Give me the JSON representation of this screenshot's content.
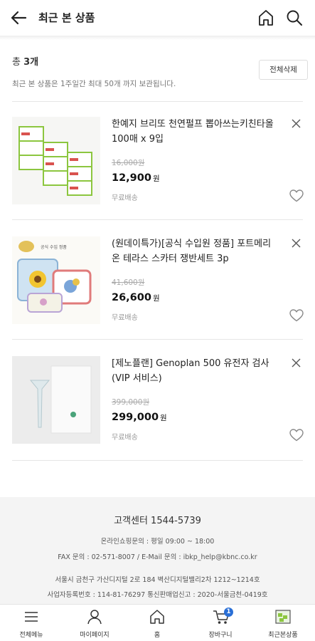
{
  "header": {
    "title": "최근 본 상품"
  },
  "summary": {
    "count_prefix": "총 ",
    "count_value": "3개",
    "note": "최근 본 상품은 1주일간 최대 50개 까지 보관됩니다.",
    "clear_all": "전체삭제"
  },
  "products": [
    {
      "name": "한예지 브리또 천연펄프 뽑아쓰는키친타올 100매 x 9입",
      "original_price": "16,000원",
      "price": "12,900",
      "currency": "원",
      "shipping": "무료배송"
    },
    {
      "name": "(원데이특가)[공식 수입원 정품] 포트메리온 테라스 스카터 쟁반세트 3p",
      "original_price": "41,600원",
      "price": "26,600",
      "currency": "원",
      "shipping": "무료배송",
      "thumb_label": "공식 수입 정품"
    },
    {
      "name": "[제노플랜] Genoplan 500 유전자 검사 (VIP 서비스)",
      "original_price": "399,000원",
      "price": "299,000",
      "currency": "원",
      "shipping": "무료배송"
    }
  ],
  "footer": {
    "cs": "고객센터 1544-5739",
    "hours": "온라인쇼핑문의 : 평일 09:00 ~ 18:00",
    "contact": "FAX 문의 : 02-571-8007 / E-Mail 문의 : ibkp_help@kbnc.co.kr",
    "address": "서울시 금천구 가산디지털 2로 184 벽산디지털밸리2차 1212~1214호",
    "registration": "사업자등록번호 : 114-81-76297 통신판매업신고 : 2020-서울금천-0419호"
  },
  "tabbar": {
    "items": [
      {
        "label": "전체메뉴",
        "icon": "menu-icon"
      },
      {
        "label": "마이페이지",
        "icon": "person-icon"
      },
      {
        "label": "홈",
        "icon": "home-icon"
      },
      {
        "label": "장바구니",
        "icon": "cart-icon",
        "badge": "1"
      },
      {
        "label": "최근본상품",
        "icon": "recent-thumb-icon"
      }
    ]
  },
  "colors": {
    "badge": "#2a6fd6",
    "footer_bg": "#f4f4f4"
  }
}
